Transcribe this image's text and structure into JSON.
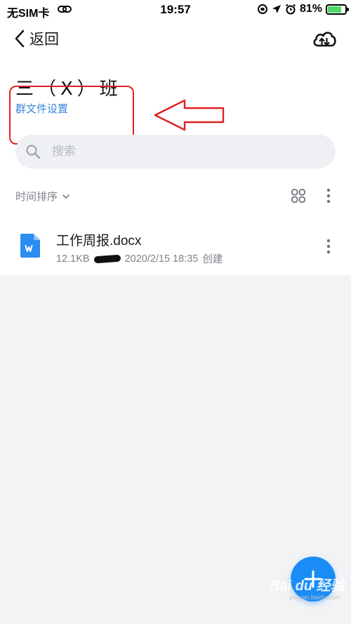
{
  "status_bar": {
    "carrier": "无SIM卡",
    "time": "19:57",
    "battery_percent": "81%",
    "battery_level": 0.81,
    "icons": [
      "link-icon",
      "orientation-lock-icon",
      "location-icon",
      "alarm-icon",
      "battery-icon"
    ]
  },
  "nav": {
    "back_label": "返回",
    "upload_icon": "cloud-upload-icon"
  },
  "group": {
    "title": "三（X）班",
    "settings_link": "群文件设置"
  },
  "search": {
    "placeholder": "搜索"
  },
  "toolbar": {
    "sort_label": "时间排序",
    "view_icon": "grid-view-icon",
    "more_icon": "more-vertical-icon"
  },
  "files": [
    {
      "name": "工作周报.docx",
      "size": "12.1KB",
      "date": "2020/2/15 18:35",
      "action": "创建",
      "icon": "word-doc-icon"
    }
  ],
  "fab": {
    "icon": "plus-icon"
  },
  "watermark": {
    "text": "Bai du 经验",
    "sub": "jingyan.baidu.com"
  },
  "colors": {
    "accent": "#1a8cf5",
    "link": "#3a86d8",
    "annotation_red": "#e02020",
    "background": "#f2f3f5"
  }
}
